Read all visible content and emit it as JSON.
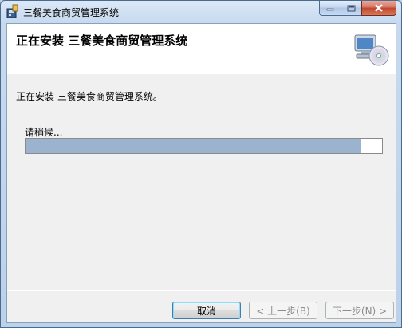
{
  "window": {
    "title": "三餐美食商贸管理系统"
  },
  "caption_buttons": {
    "minimize_icon": "minimize-icon",
    "maximize_icon": "maximize-icon",
    "close_icon": "close-icon"
  },
  "banner": {
    "title": "正在安装  三餐美食商贸管理系统",
    "graphic_icon": "computer-cd-icon"
  },
  "status": {
    "text": "正在安装  三餐美食商贸管理系统。"
  },
  "progress": {
    "label": "请稍候...",
    "fraction": 0.94,
    "fill_color": "#9bb3cf"
  },
  "buttons": {
    "cancel": "取消",
    "back": "< 上一步(B)",
    "next": "下一步(N) >"
  }
}
